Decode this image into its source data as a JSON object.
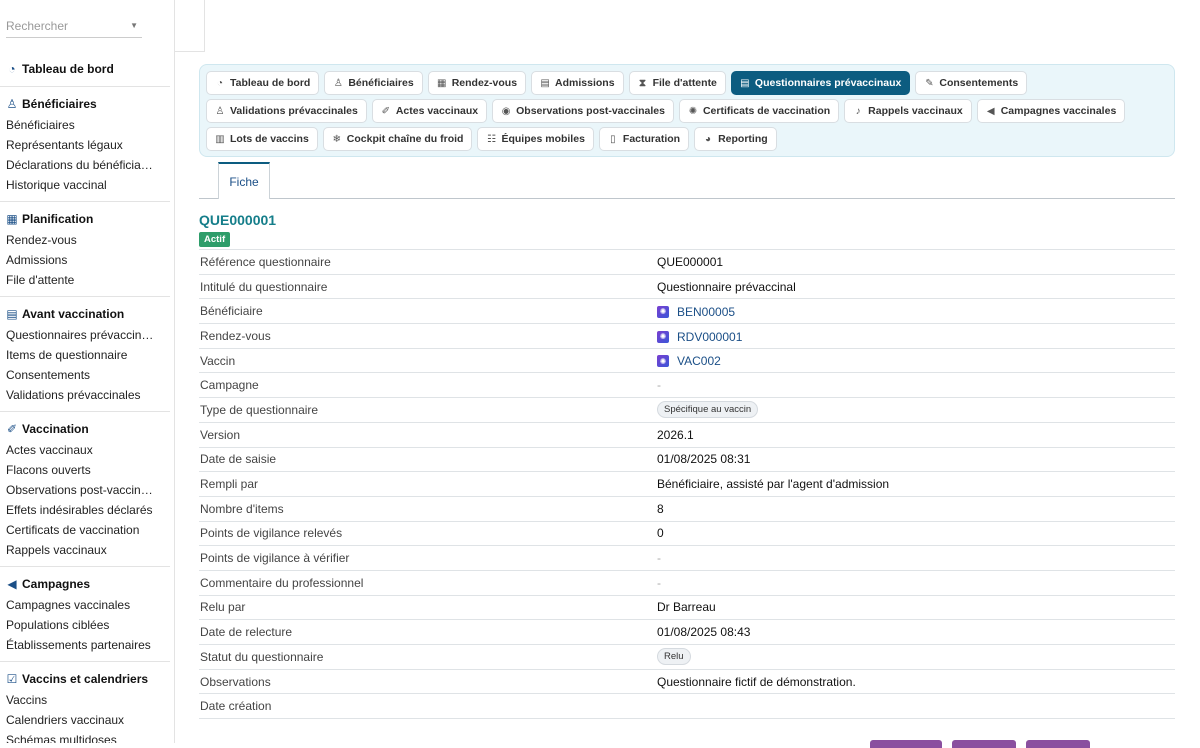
{
  "sidebar": {
    "search_placeholder": "Rechercher",
    "groups": [
      {
        "title": "Tableau de bord",
        "icon": "gauge-icon",
        "items": []
      },
      {
        "title": "Bénéficiaires",
        "icon": "people-icon",
        "items": [
          "Bénéficiaires",
          "Représentants légaux",
          "Déclarations du bénéficia…",
          "Historique vaccinal"
        ]
      },
      {
        "title": "Planification",
        "icon": "calendar-icon",
        "items": [
          "Rendez-vous",
          "Admissions",
          "File d'attente"
        ]
      },
      {
        "title": "Avant vaccination",
        "icon": "clipboard-icon",
        "items": [
          "Questionnaires prévaccin…",
          "Items de questionnaire",
          "Consentements",
          "Validations prévaccinales"
        ]
      },
      {
        "title": "Vaccination",
        "icon": "syringe-icon",
        "items": [
          "Actes vaccinaux",
          "Flacons ouverts",
          "Observations post-vaccin…",
          "Effets indésirables déclarés",
          "Certificats de vaccination",
          "Rappels vaccinaux"
        ]
      },
      {
        "title": "Campagnes",
        "icon": "megaphone-icon",
        "items": [
          "Campagnes vaccinales",
          "Populations ciblées",
          "Établissements partenaires"
        ]
      },
      {
        "title": "Vaccins et calendriers",
        "icon": "calendar-check-icon",
        "items": [
          "Vaccins",
          "Calendriers vaccinaux",
          "Schémas multidoses"
        ]
      }
    ]
  },
  "tabs": [
    {
      "label": "Tableau de bord",
      "icon": "gauge-icon",
      "glyph": "◔"
    },
    {
      "label": "Bénéficiaires",
      "icon": "people-icon",
      "glyph": "♙"
    },
    {
      "label": "Rendez-vous",
      "icon": "calendar-icon",
      "glyph": "▦"
    },
    {
      "label": "Admissions",
      "icon": "clipboard-icon",
      "glyph": "▤"
    },
    {
      "label": "File d'attente",
      "icon": "hourglass-icon",
      "glyph": "⧗"
    },
    {
      "label": "Questionnaires prévaccinaux",
      "icon": "clipboard-list-icon",
      "glyph": "▤",
      "active": true
    },
    {
      "label": "Consentements",
      "icon": "signature-icon",
      "glyph": "✎"
    },
    {
      "label": "Validations prévaccinales",
      "icon": "user-check-icon",
      "glyph": "♙"
    },
    {
      "label": "Actes vaccinaux",
      "icon": "syringe-icon",
      "glyph": "✐"
    },
    {
      "label": "Observations post-vaccinales",
      "icon": "eye-icon",
      "glyph": "◉"
    },
    {
      "label": "Certificats de vaccination",
      "icon": "certificate-icon",
      "glyph": "✺"
    },
    {
      "label": "Rappels vaccinaux",
      "icon": "bell-icon",
      "glyph": "♪"
    },
    {
      "label": "Campagnes vaccinales",
      "icon": "megaphone-icon",
      "glyph": "◀"
    },
    {
      "label": "Lots de vaccins",
      "icon": "barcode-icon",
      "glyph": "▥"
    },
    {
      "label": "Cockpit chaîne du froid",
      "icon": "snowflake-icon",
      "glyph": "❄"
    },
    {
      "label": "Équipes mobiles",
      "icon": "users-icon",
      "glyph": "☷"
    },
    {
      "label": "Facturation",
      "icon": "invoice-icon",
      "glyph": "▯"
    },
    {
      "label": "Reporting",
      "icon": "pie-chart-icon",
      "glyph": "◕"
    }
  ],
  "subtab": {
    "label": "Fiche"
  },
  "record": {
    "title": "QUE000001",
    "status_badge": "Actif",
    "fields": [
      {
        "key": "Référence questionnaire",
        "value": "QUE000001",
        "kind": "text"
      },
      {
        "key": "Intitulé du questionnaire",
        "value": "Questionnaire prévaccinal",
        "kind": "text"
      },
      {
        "key": "Bénéficiaire",
        "value": "BEN00005",
        "kind": "link"
      },
      {
        "key": "Rendez-vous",
        "value": "RDV000001",
        "kind": "link"
      },
      {
        "key": "Vaccin",
        "value": "VAC002",
        "kind": "link"
      },
      {
        "key": "Campagne",
        "value": "-",
        "kind": "muted"
      },
      {
        "key": "Type de questionnaire",
        "value": "Spécifique au vaccin",
        "kind": "pill"
      },
      {
        "key": "Version",
        "value": "2026.1",
        "kind": "text"
      },
      {
        "key": "Date de saisie",
        "value": "01/08/2025 08:31",
        "kind": "text"
      },
      {
        "key": "Rempli par",
        "value": "Bénéficiaire, assisté par l'agent d'admission",
        "kind": "text"
      },
      {
        "key": "Nombre d'items",
        "value": "8",
        "kind": "text"
      },
      {
        "key": "Points de vigilance relevés",
        "value": "0",
        "kind": "text"
      },
      {
        "key": "Points de vigilance à vérifier",
        "value": "-",
        "kind": "muted"
      },
      {
        "key": "Commentaire du professionnel",
        "value": "-",
        "kind": "muted"
      },
      {
        "key": "Relu par",
        "value": "Dr Barreau",
        "kind": "text"
      },
      {
        "key": "Date de relecture",
        "value": "01/08/2025 08:43",
        "kind": "text"
      },
      {
        "key": "Statut du questionnaire",
        "value": "Relu",
        "kind": "pill"
      },
      {
        "key": "Observations",
        "value": "Questionnaire fictif de démonstration.",
        "kind": "text"
      },
      {
        "key": "Date création",
        "value": "",
        "kind": "text"
      }
    ]
  }
}
